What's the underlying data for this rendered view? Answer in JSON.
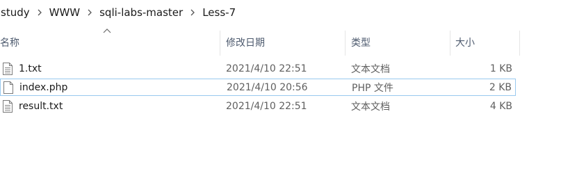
{
  "breadcrumb": {
    "items": [
      "study",
      "WWW",
      "sqli-labs-master",
      "Less-7"
    ]
  },
  "columns": {
    "name": "名称",
    "date": "修改日期",
    "type": "类型",
    "size": "大小"
  },
  "sort": {
    "column": "name",
    "direction": "ascending"
  },
  "files": [
    {
      "name": "1.txt",
      "date": "2021/4/10 22:51",
      "type": "文本文档",
      "size": "1 KB",
      "icon": "text-file-icon"
    },
    {
      "name": "index.php",
      "date": "2021/4/10 20:56",
      "type": "PHP 文件",
      "size": "2 KB",
      "icon": "blank-file-icon",
      "selected": true
    },
    {
      "name": "result.txt",
      "date": "2021/4/10 22:51",
      "type": "文本文档",
      "size": "4 KB",
      "icon": "text-file-icon"
    }
  ],
  "colors": {
    "selection_border": "#99c9ef",
    "header_text": "#4d5a6e"
  }
}
